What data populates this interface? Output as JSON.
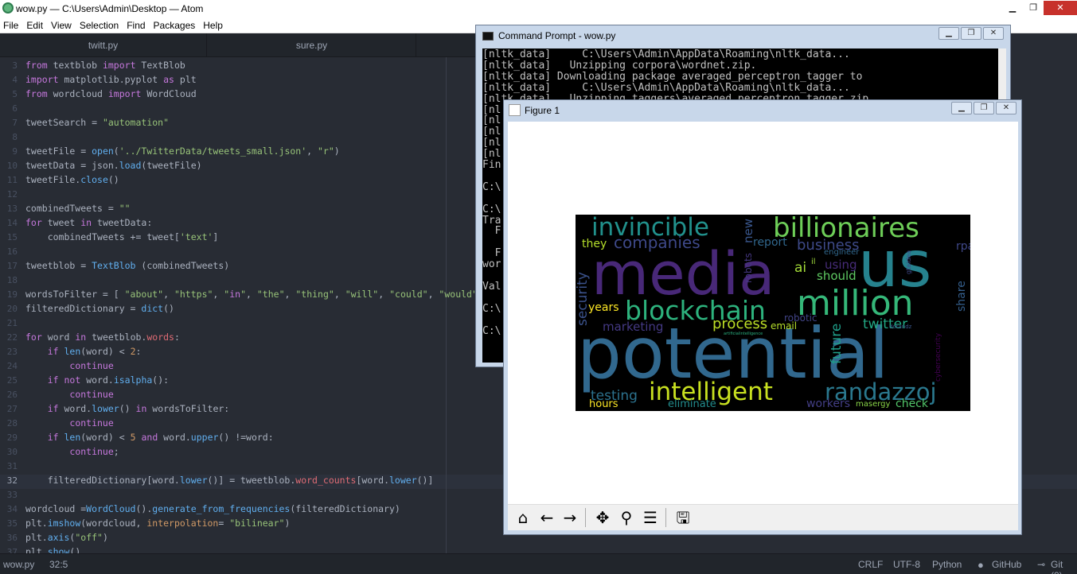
{
  "atom": {
    "title": "wow.py — C:\\Users\\Admin\\Desktop — Atom",
    "menu": [
      "File",
      "Edit",
      "View",
      "Selection",
      "Find",
      "Packages",
      "Help"
    ],
    "tabs": [
      "twitt.py",
      "sure.py"
    ],
    "status": {
      "file": "wow.py",
      "cursor": "32:5",
      "line_ending": "CRLF",
      "encoding": "UTF-8",
      "grammar": "Python",
      "github": "GitHub",
      "git": "Git (0)"
    }
  },
  "editor": {
    "active_line": "32",
    "lines": [
      {
        "n": "3",
        "t": ""
      },
      {
        "n": "4",
        "t": ""
      },
      {
        "n": "5",
        "t": ""
      },
      {
        "n": "6",
        "t": ""
      },
      {
        "n": "7",
        "t": ""
      },
      {
        "n": "8",
        "t": ""
      },
      {
        "n": "9",
        "t": ""
      },
      {
        "n": "10",
        "t": ""
      },
      {
        "n": "11",
        "t": ""
      },
      {
        "n": "12",
        "t": ""
      },
      {
        "n": "13",
        "t": ""
      },
      {
        "n": "14",
        "t": ""
      },
      {
        "n": "15",
        "t": ""
      },
      {
        "n": "16",
        "t": ""
      },
      {
        "n": "17",
        "t": ""
      },
      {
        "n": "18",
        "t": ""
      },
      {
        "n": "19",
        "t": ""
      },
      {
        "n": "20",
        "t": ""
      },
      {
        "n": "21",
        "t": ""
      },
      {
        "n": "22",
        "t": ""
      },
      {
        "n": "23",
        "t": ""
      },
      {
        "n": "24",
        "t": ""
      },
      {
        "n": "25",
        "t": ""
      },
      {
        "n": "26",
        "t": ""
      },
      {
        "n": "27",
        "t": ""
      },
      {
        "n": "28",
        "t": ""
      },
      {
        "n": "29",
        "t": ""
      },
      {
        "n": "30",
        "t": ""
      },
      {
        "n": "31",
        "t": ""
      },
      {
        "n": "32",
        "t": ""
      },
      {
        "n": "33",
        "t": ""
      },
      {
        "n": "34",
        "t": ""
      },
      {
        "n": "35",
        "t": ""
      },
      {
        "n": "36",
        "t": ""
      },
      {
        "n": "37",
        "t": ""
      }
    ],
    "code": [
      "from textblob import TextBlob",
      "import matplotlib.pyplot as plt",
      "from wordcloud import WordCloud",
      "",
      "tweetSearch = \"automation\"",
      "",
      "tweetFile = open('../TwitterData/tweets_small.json', \"r\")",
      "tweetData = json.load(tweetFile)",
      "tweetFile.close()",
      "",
      "combinedTweets = \"\"",
      "for tweet in tweetData:",
      "    combinedTweets += tweet['text']",
      "",
      "tweetblob = TextBlob (combinedTweets)",
      "",
      "wordsToFilter = [ \"about\", \"https\", \"in\", \"the\", \"thing\", \"will\", \"could\", \"would\", \"",
      "filteredDictionary = dict()",
      "",
      "for word in tweetblob.words:",
      "    if len(word) < 2:",
      "        continue",
      "    if not word.isalpha():",
      "        continue",
      "    if word.lower() in wordsToFilter:",
      "        continue",
      "    if len(word) < 5 and word.upper() !=word:",
      "        continue;",
      "",
      "    filteredDictionary[word.lower()] = tweetblob.word_counts[word.lower()]",
      "",
      "wordcloud =WordCloud().generate_from_frequencies(filteredDictionary)",
      "plt.imshow(wordcloud, interpolation= \"bilinear\")",
      "plt.axis(\"off\")",
      "plt.show()"
    ]
  },
  "cmd": {
    "title": "Command Prompt - wow.py",
    "lines": [
      "[nltk_data]     C:\\Users\\Admin\\AppData\\Roaming\\nltk_data...",
      "[nltk_data]   Unzipping corpora\\wordnet.zip.",
      "[nltk_data] Downloading package averaged_perceptron_tagger to",
      "[nltk_data]     C:\\Users\\Admin\\AppData\\Roaming\\nltk_data...",
      "[nltk_data]   Unzipping taggers\\averaged_perceptron_tagger.zip.",
      "[nl",
      "[nl",
      "[nl",
      "[nl",
      "[nl",
      "Fin",
      "",
      "C:\\",
      "",
      "C:\\",
      "Tra",
      "  F",
      "",
      "  F",
      "wor",
      "",
      "Val",
      "",
      "C:\\",
      "",
      "C:\\"
    ]
  },
  "figure": {
    "title": "Figure 1",
    "toolbar": [
      "home-icon",
      "back-icon",
      "forward-icon",
      "pan-icon",
      "zoom-icon",
      "configure-icon",
      "save-icon"
    ],
    "words": [
      {
        "w": "potential",
        "color": "#31688e"
      },
      {
        "w": "media",
        "color": "#482878"
      },
      {
        "w": "us",
        "color": "#26828e"
      },
      {
        "w": "million",
        "color": "#35b779"
      },
      {
        "w": "blockchain",
        "color": "#2db27d"
      },
      {
        "w": "billionaires",
        "color": "#6ece58"
      },
      {
        "w": "invincible",
        "color": "#21918c"
      },
      {
        "w": "intelligent",
        "color": "#c8e020"
      },
      {
        "w": "randazzoj",
        "color": "#2a788e"
      },
      {
        "w": "companies",
        "color": "#3e4989"
      },
      {
        "w": "business",
        "color": "#3e4a89"
      },
      {
        "w": "twitter",
        "color": "#22a884"
      },
      {
        "w": "process",
        "color": "#bddf26"
      },
      {
        "w": "testing",
        "color": "#2c728e"
      },
      {
        "w": "marketing",
        "color": "#443983"
      },
      {
        "w": "security",
        "color": "#3b528b"
      },
      {
        "w": "report",
        "color": "#31688e"
      },
      {
        "w": "they",
        "color": "#b5de2b"
      },
      {
        "w": "years",
        "color": "#fde725"
      },
      {
        "w": "hours",
        "color": "#fde725"
      },
      {
        "w": "eliminate",
        "color": "#228c8d"
      },
      {
        "w": "workers",
        "color": "#433e85"
      },
      {
        "w": "check",
        "color": "#52c569"
      },
      {
        "w": "future",
        "color": "#1f9e89"
      },
      {
        "w": "using",
        "color": "#472c7a"
      },
      {
        "w": "should",
        "color": "#5ec962"
      },
      {
        "w": "email",
        "color": "#b5de2b"
      },
      {
        "w": "robotic",
        "color": "#414487"
      },
      {
        "w": "share",
        "color": "#355f8d"
      },
      {
        "w": "rpa",
        "color": "#3f4889"
      },
      {
        "w": "new",
        "color": "#39568c"
      },
      {
        "w": "robots",
        "color": "#453781"
      },
      {
        "w": "ai",
        "color": "#a2da37"
      },
      {
        "w": "cybersecurity",
        "color": "#440154"
      },
      {
        "w": "engineer",
        "color": "#31688e"
      },
      {
        "w": "masergy",
        "color": "#89d548"
      },
      {
        "w": "gtaidea",
        "color": "#3e4989"
      },
      {
        "w": "dotandz",
        "color": "#39568c"
      },
      {
        "w": "il",
        "color": "#9fda3a"
      },
      {
        "w": "artificialintelligence",
        "color": "#2ab07f"
      }
    ]
  }
}
